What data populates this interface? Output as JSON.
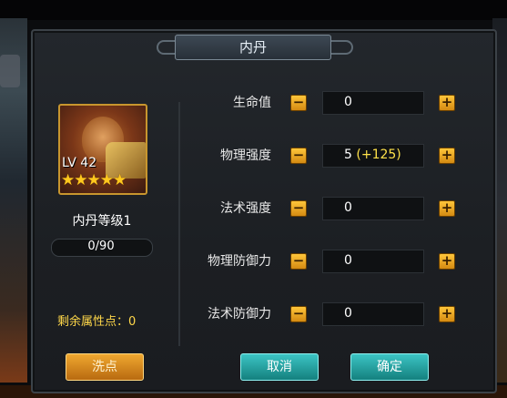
{
  "dialog": {
    "title": "内丹"
  },
  "hero": {
    "level_text": "LV 42",
    "stars": "★★★★★",
    "dan_level": "内丹等级1",
    "xp_text": "0/90",
    "xp_progress": 0
  },
  "remaining_points": {
    "label": "剩余属性点：",
    "value": "0"
  },
  "attributes": [
    {
      "label": "生命值",
      "value": "0",
      "bonus": ""
    },
    {
      "label": "物理强度",
      "value": "5",
      "bonus": "(+125)"
    },
    {
      "label": "法术强度",
      "value": "0",
      "bonus": ""
    },
    {
      "label": "物理防御力",
      "value": "0",
      "bonus": ""
    },
    {
      "label": "法术防御力",
      "value": "0",
      "bonus": ""
    }
  ],
  "buttons": {
    "wash": "洗点",
    "cancel": "取消",
    "confirm": "确定",
    "minus": "−",
    "plus": "+"
  },
  "colors": {
    "accent_gold": "#c8962e",
    "button_teal": "#14807e",
    "bonus_yellow": "#ffe24a"
  }
}
